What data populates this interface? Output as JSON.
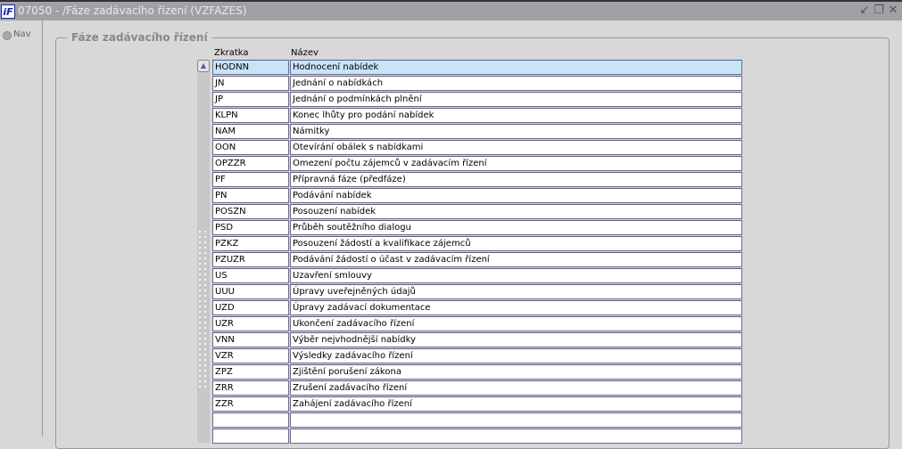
{
  "window": {
    "title": "07050 - /Fáze zadávacího řízení (VZFAZES)",
    "logo": "iF",
    "minimize": "↙",
    "restore": "❐",
    "close": "✕"
  },
  "nav": {
    "label": "Nav"
  },
  "frame": {
    "title": "Fáze zadávacího řízení"
  },
  "table": {
    "headers": {
      "code": "Zkratka",
      "name": "Název"
    },
    "rows": [
      {
        "code": "HODNN",
        "name": "Hodnocení nabídek"
      },
      {
        "code": "JN",
        "name": "Jednání o nabídkách"
      },
      {
        "code": "JP",
        "name": "Jednání o podmínkách plnění"
      },
      {
        "code": "KLPN",
        "name": "Konec lhůty pro podání nabídek"
      },
      {
        "code": "NAM",
        "name": "Námitky"
      },
      {
        "code": "OON",
        "name": "Otevírání obálek s nabídkami"
      },
      {
        "code": "OPZZR",
        "name": "Omezení počtu zájemců v zadávacím řízení"
      },
      {
        "code": "PF",
        "name": "Přípravná fáze (předfáze)"
      },
      {
        "code": "PN",
        "name": "Podávání nabídek"
      },
      {
        "code": "POSZN",
        "name": "Posouzení nabídek"
      },
      {
        "code": "PSD",
        "name": "Průběh soutěžního dialogu"
      },
      {
        "code": "PZKZ",
        "name": "Posouzení žádostí a kvalifikace zájemců"
      },
      {
        "code": "PZUZR",
        "name": "Podávání žádostí o účast v zadávacím řízení"
      },
      {
        "code": "US",
        "name": "Uzavření smlouvy"
      },
      {
        "code": "UUU",
        "name": "Úpravy uveřejněných údajů"
      },
      {
        "code": "UZD",
        "name": "Úpravy zadávací dokumentace"
      },
      {
        "code": "UZR",
        "name": "Ukončení zadávacího řízení"
      },
      {
        "code": "VNN",
        "name": "Výběr nejvhodnější nabídky"
      },
      {
        "code": "VZR",
        "name": "Výsledky zadávacího řízení"
      },
      {
        "code": "ZPZ",
        "name": "Zjištění porušení zákona"
      },
      {
        "code": "ZRR",
        "name": "Zrušení zadávacího řízení"
      },
      {
        "code": "ZZR",
        "name": "Zahájení zadávacího řízení"
      },
      {
        "code": "",
        "name": ""
      },
      {
        "code": "",
        "name": ""
      }
    ]
  }
}
